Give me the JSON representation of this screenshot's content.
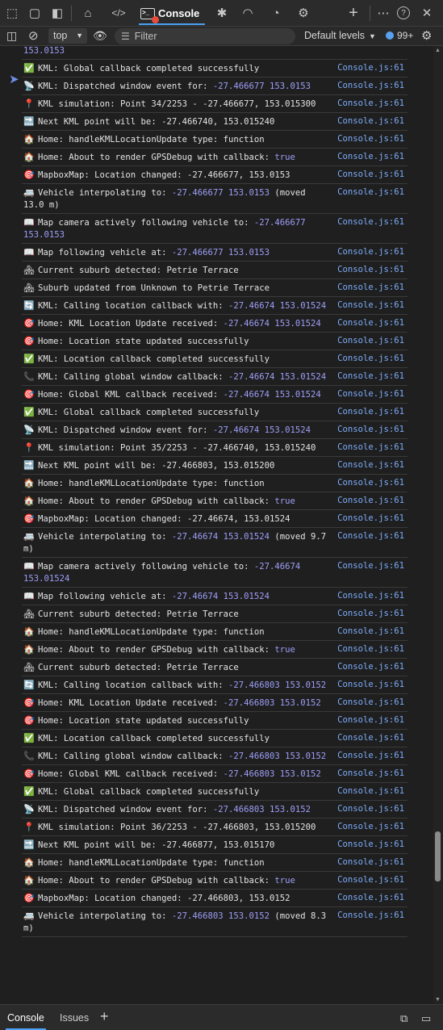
{
  "tabbar": {
    "tabs": [
      {
        "name": "inspect-icon",
        "glyph": "⬚"
      },
      {
        "name": "device-emulation-icon",
        "glyph": "▢"
      },
      {
        "name": "dock-icon",
        "glyph": "◧"
      },
      {
        "name": "welcome-icon",
        "glyph": "⌂"
      },
      {
        "name": "elements-icon",
        "glyph": "</>"
      },
      {
        "name": "debugger-icon",
        "glyph": "✱"
      },
      {
        "name": "network-icon",
        "glyph": "◠"
      },
      {
        "name": "performance-icon",
        "glyph": "◔"
      },
      {
        "name": "settings-gear-icon",
        "glyph": "⚙"
      }
    ],
    "active_label": "Console",
    "add": "+",
    "more": "⋯",
    "help": "?",
    "close": "✕"
  },
  "toolbar": {
    "context": "top",
    "filter_placeholder": "Filter",
    "levels": "Default levels",
    "issues_count": "99+"
  },
  "logs": [
    {
      "emoji": "",
      "parts": [
        {
          "t": "153.0153",
          "c": "num"
        }
      ],
      "src": ""
    },
    {
      "emoji": "✅",
      "parts": [
        {
          "t": "KML: Global callback completed successfully"
        }
      ],
      "src": "Console.js:61"
    },
    {
      "emoji": "📡",
      "parts": [
        {
          "t": "KML: Dispatched window event for: "
        },
        {
          "t": "-27.466677 153.0153",
          "c": "num"
        }
      ],
      "src": "Console.js:61"
    },
    {
      "emoji": "📍",
      "parts": [
        {
          "t": "KML simulation: Point 34/2253 - -27.466677, 153.015300"
        }
      ],
      "src": "Console.js:61"
    },
    {
      "emoji": "🔜",
      "parts": [
        {
          "t": "Next KML point will be: -27.466740, 153.015240"
        }
      ],
      "src": "Console.js:61"
    },
    {
      "emoji": "🏠",
      "parts": [
        {
          "t": "Home: handleKMLLocationUpdate type: function"
        }
      ],
      "src": "Console.js:61"
    },
    {
      "emoji": "🏠",
      "parts": [
        {
          "t": "Home: About to render GPSDebug with callback: "
        },
        {
          "t": "true",
          "c": "kw"
        }
      ],
      "src": "Console.js:61"
    },
    {
      "emoji": "🎯",
      "parts": [
        {
          "t": "MapboxMap: Location changed: -27.466677, 153.0153"
        }
      ],
      "src": "Console.js:61"
    },
    {
      "emoji": "🚐",
      "parts": [
        {
          "t": "Vehicle interpolating to: "
        },
        {
          "t": "-27.466677 153.0153",
          "c": "num"
        },
        {
          "t": " (moved 13.0 m)"
        }
      ],
      "src": "Console.js:61"
    },
    {
      "emoji": "📖",
      "parts": [
        {
          "t": "Map camera actively following vehicle to: "
        },
        {
          "t": "-27.466677 153.0153",
          "c": "num"
        }
      ],
      "src": "Console.js:61"
    },
    {
      "emoji": "📖",
      "parts": [
        {
          "t": "Map following vehicle at: "
        },
        {
          "t": "-27.466677 153.0153",
          "c": "num"
        }
      ],
      "src": "Console.js:61"
    },
    {
      "emoji": "🏘",
      "parts": [
        {
          "t": "Current suburb detected: Petrie Terrace"
        }
      ],
      "src": "Console.js:61"
    },
    {
      "emoji": "🏘",
      "parts": [
        {
          "t": "Suburb updated from Unknown to Petrie Terrace"
        }
      ],
      "src": "Console.js:61"
    },
    {
      "emoji": "🔄",
      "parts": [
        {
          "t": "KML: Calling location callback with: "
        },
        {
          "t": "-27.46674 153.01524",
          "c": "num"
        }
      ],
      "src": "Console.js:61"
    },
    {
      "emoji": "🎯",
      "parts": [
        {
          "t": "Home: KML Location Update received: "
        },
        {
          "t": "-27.46674 153.01524",
          "c": "num"
        }
      ],
      "src": "Console.js:61"
    },
    {
      "emoji": "🎯",
      "parts": [
        {
          "t": "Home: Location state updated successfully"
        }
      ],
      "src": "Console.js:61"
    },
    {
      "emoji": "✅",
      "parts": [
        {
          "t": "KML: Location callback completed successfully"
        }
      ],
      "src": "Console.js:61"
    },
    {
      "emoji": "📞",
      "parts": [
        {
          "t": "KML: Calling global window callback: "
        },
        {
          "t": "-27.46674 153.01524",
          "c": "num"
        }
      ],
      "src": "Console.js:61"
    },
    {
      "emoji": "🎯",
      "parts": [
        {
          "t": "Home: Global KML callback received: "
        },
        {
          "t": "-27.46674 153.01524",
          "c": "num"
        }
      ],
      "src": "Console.js:61"
    },
    {
      "emoji": "✅",
      "parts": [
        {
          "t": "KML: Global callback completed successfully"
        }
      ],
      "src": "Console.js:61"
    },
    {
      "emoji": "📡",
      "parts": [
        {
          "t": "KML: Dispatched window event for: "
        },
        {
          "t": "-27.46674 153.01524",
          "c": "num"
        }
      ],
      "src": "Console.js:61"
    },
    {
      "emoji": "📍",
      "parts": [
        {
          "t": "KML simulation: Point 35/2253 - -27.466740, 153.015240"
        }
      ],
      "src": "Console.js:61"
    },
    {
      "emoji": "🔜",
      "parts": [
        {
          "t": "Next KML point will be: -27.466803, 153.015200"
        }
      ],
      "src": "Console.js:61"
    },
    {
      "emoji": "🏠",
      "parts": [
        {
          "t": "Home: handleKMLLocationUpdate type: function"
        }
      ],
      "src": "Console.js:61"
    },
    {
      "emoji": "🏠",
      "parts": [
        {
          "t": "Home: About to render GPSDebug with callback: "
        },
        {
          "t": "true",
          "c": "kw"
        }
      ],
      "src": "Console.js:61"
    },
    {
      "emoji": "🎯",
      "parts": [
        {
          "t": "MapboxMap: Location changed: -27.46674, 153.01524"
        }
      ],
      "src": "Console.js:61"
    },
    {
      "emoji": "🚐",
      "parts": [
        {
          "t": "Vehicle interpolating to: "
        },
        {
          "t": "-27.46674 153.01524",
          "c": "num"
        },
        {
          "t": " (moved 9.7 m)"
        }
      ],
      "src": "Console.js:61"
    },
    {
      "emoji": "📖",
      "parts": [
        {
          "t": "Map camera actively following vehicle to: "
        },
        {
          "t": "-27.46674 153.01524",
          "c": "num"
        }
      ],
      "src": "Console.js:61"
    },
    {
      "emoji": "📖",
      "parts": [
        {
          "t": "Map following vehicle at: "
        },
        {
          "t": "-27.46674 153.01524",
          "c": "num"
        }
      ],
      "src": "Console.js:61"
    },
    {
      "emoji": "🏘",
      "parts": [
        {
          "t": "Current suburb detected: Petrie Terrace"
        }
      ],
      "src": "Console.js:61"
    },
    {
      "emoji": "🏠",
      "parts": [
        {
          "t": "Home: handleKMLLocationUpdate type: function"
        }
      ],
      "src": "Console.js:61"
    },
    {
      "emoji": "🏠",
      "parts": [
        {
          "t": "Home: About to render GPSDebug with callback: "
        },
        {
          "t": "true",
          "c": "kw"
        }
      ],
      "src": "Console.js:61"
    },
    {
      "emoji": "🏘",
      "parts": [
        {
          "t": "Current suburb detected: Petrie Terrace"
        }
      ],
      "src": "Console.js:61"
    },
    {
      "emoji": "🔄",
      "parts": [
        {
          "t": "KML: Calling location callback with: "
        },
        {
          "t": "-27.466803 153.0152",
          "c": "num"
        }
      ],
      "src": "Console.js:61"
    },
    {
      "emoji": "🎯",
      "parts": [
        {
          "t": "Home: KML Location Update received: "
        },
        {
          "t": "-27.466803 153.0152",
          "c": "num"
        }
      ],
      "src": "Console.js:61"
    },
    {
      "emoji": "🎯",
      "parts": [
        {
          "t": "Home: Location state updated successfully"
        }
      ],
      "src": "Console.js:61"
    },
    {
      "emoji": "✅",
      "parts": [
        {
          "t": "KML: Location callback completed successfully"
        }
      ],
      "src": "Console.js:61"
    },
    {
      "emoji": "📞",
      "parts": [
        {
          "t": "KML: Calling global window callback: "
        },
        {
          "t": "-27.466803 153.0152",
          "c": "num"
        }
      ],
      "src": "Console.js:61"
    },
    {
      "emoji": "🎯",
      "parts": [
        {
          "t": "Home: Global KML callback received: "
        },
        {
          "t": "-27.466803 153.0152",
          "c": "num"
        }
      ],
      "src": "Console.js:61"
    },
    {
      "emoji": "✅",
      "parts": [
        {
          "t": "KML: Global callback completed successfully"
        }
      ],
      "src": "Console.js:61"
    },
    {
      "emoji": "📡",
      "parts": [
        {
          "t": "KML: Dispatched window event for: "
        },
        {
          "t": "-27.466803 153.0152",
          "c": "num"
        }
      ],
      "src": "Console.js:61"
    },
    {
      "emoji": "📍",
      "parts": [
        {
          "t": "KML simulation: Point 36/2253 - -27.466803, 153.015200"
        }
      ],
      "src": "Console.js:61"
    },
    {
      "emoji": "🔜",
      "parts": [
        {
          "t": "Next KML point will be: -27.466877, 153.015170"
        }
      ],
      "src": "Console.js:61"
    },
    {
      "emoji": "🏠",
      "parts": [
        {
          "t": "Home: handleKMLLocationUpdate type: function"
        }
      ],
      "src": "Console.js:61"
    },
    {
      "emoji": "🏠",
      "parts": [
        {
          "t": "Home: About to render GPSDebug with callback: "
        },
        {
          "t": "true",
          "c": "kw"
        }
      ],
      "src": "Console.js:61"
    },
    {
      "emoji": "🎯",
      "parts": [
        {
          "t": "MapboxMap: Location changed: -27.466803, 153.0152"
        }
      ],
      "src": "Console.js:61"
    },
    {
      "emoji": "🚐",
      "parts": [
        {
          "t": "Vehicle interpolating to: "
        },
        {
          "t": "-27.466803 153.0152",
          "c": "num"
        },
        {
          "t": " (moved 8.3 m)"
        }
      ],
      "src": "Console.js:61"
    }
  ],
  "drawer": {
    "tab_console": "Console",
    "tab_issues": "Issues",
    "add": "+"
  },
  "colors": {
    "background": "#1f1f1f",
    "accent": "#4ca0f5",
    "number_value": "#9e9ef9",
    "source_link": "#7cacf8"
  }
}
